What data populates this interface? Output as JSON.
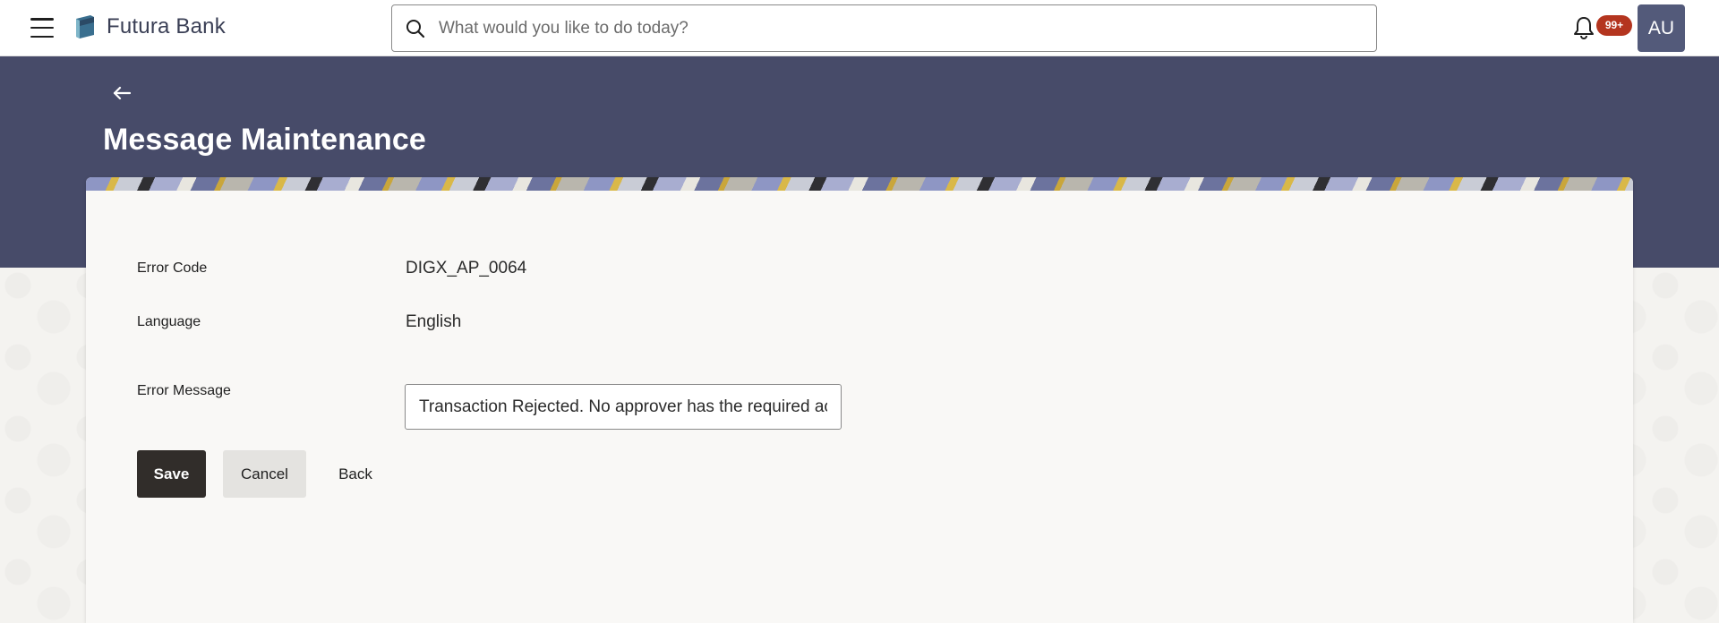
{
  "app": {
    "brand_name": "Futura Bank",
    "notification_count": "99+",
    "user_initials": "AU"
  },
  "search": {
    "placeholder": "What would you like to do today?",
    "value": ""
  },
  "page": {
    "title": "Message Maintenance"
  },
  "form": {
    "error_code_label": "Error Code",
    "error_code_value": "DIGX_AP_0064",
    "language_label": "Language",
    "language_value": "English",
    "error_message_label": "Error Message",
    "error_message_value": "Transaction Rejected. No approver has the required access"
  },
  "actions": {
    "save_label": "Save",
    "cancel_label": "Cancel",
    "back_label": "Back"
  },
  "colors": {
    "banner": "#474b69",
    "avatar": "#535a7a",
    "badge": "#b4351f",
    "primary_button": "#312d2a"
  },
  "icons": [
    "menu-icon",
    "logo-icon",
    "search-icon",
    "bell-icon",
    "back-arrow-icon"
  ]
}
